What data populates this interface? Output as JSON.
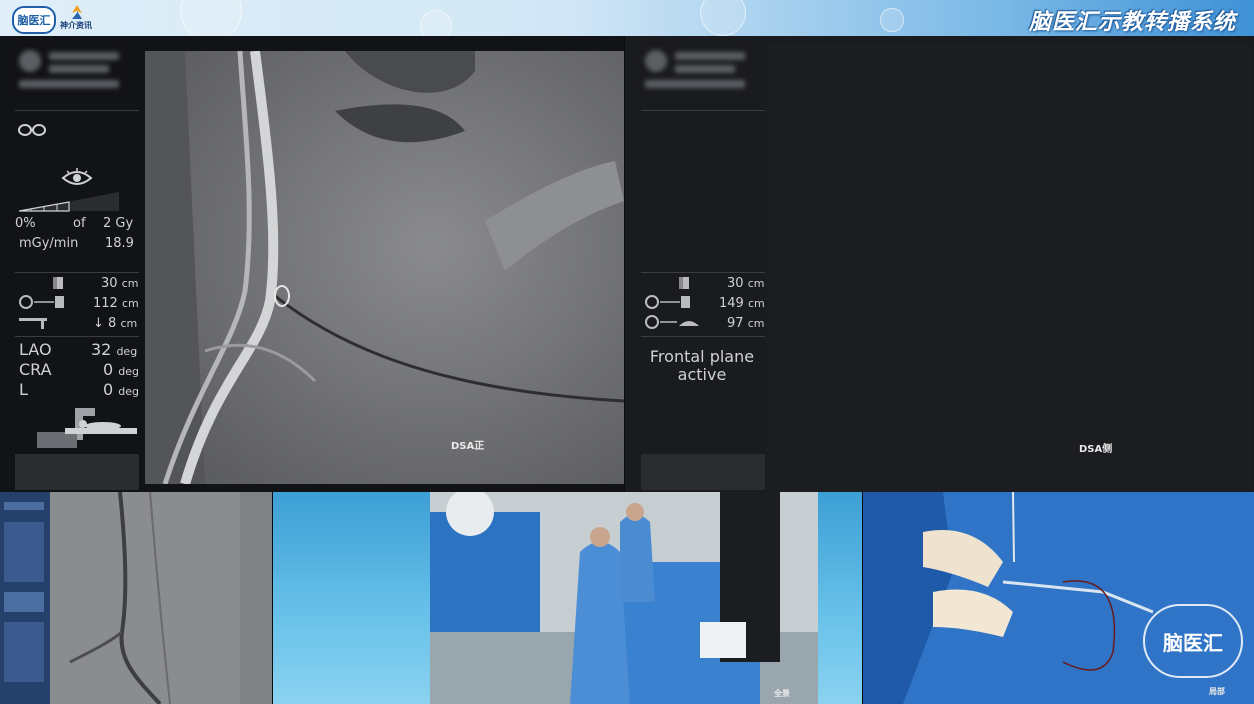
{
  "header": {
    "logo_left_text": "脑医汇",
    "logo_right_text": "神介资讯",
    "system_title": "脑医汇示教转播系统"
  },
  "left_monitor": {
    "dose_percent": "0%",
    "dose_of": "of",
    "dose_total": "2 Gy",
    "rate_unit": "mGy/min",
    "rate_value": "18.9",
    "dist1_value": "30",
    "dist1_unit": "cm",
    "dist2_value": "112",
    "dist2_unit": "cm",
    "dist3_value": "↓ 8",
    "dist3_unit": "cm",
    "angles": [
      {
        "label": "LAO",
        "value": "32",
        "unit": "deg"
      },
      {
        "label": "CRA",
        "value": "0",
        "unit": "deg"
      },
      {
        "label": "L",
        "value": "0",
        "unit": "deg"
      }
    ],
    "view_label": "DSA正"
  },
  "right_monitor": {
    "dist1_value": "30",
    "dist1_unit": "cm",
    "dist2_value": "149",
    "dist2_unit": "cm",
    "dist3_value": "97",
    "dist3_unit": "cm",
    "status_line1": "Frontal plane",
    "status_line2": "active",
    "view_label": "DSA侧"
  },
  "bottom": {
    "cam2_label": "全景",
    "cam3_label": "局部",
    "watermark": "脑医汇"
  }
}
